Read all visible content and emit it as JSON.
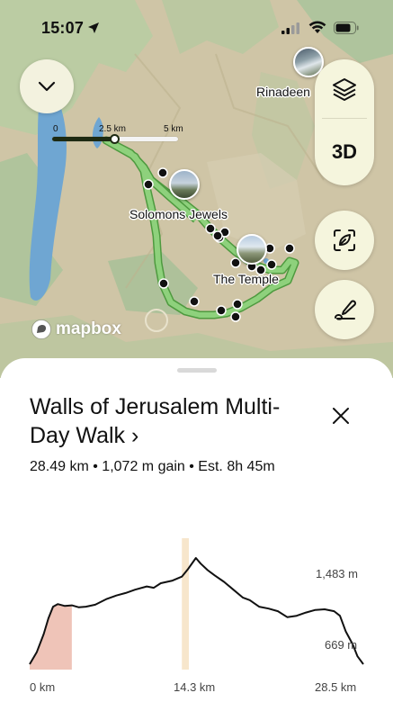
{
  "status_bar": {
    "time": "15:07",
    "icons": [
      "location-arrow-icon",
      "cellular-signal-icon",
      "wifi-icon",
      "battery-icon"
    ]
  },
  "map": {
    "scale": {
      "labels": [
        "0",
        "2.5 km",
        "5 km"
      ]
    },
    "places": [
      {
        "name": "Rinadeena",
        "visible_text": "Rinadeen"
      },
      {
        "name": "Solomons Jewels",
        "visible_text": "Solomons Jewels"
      },
      {
        "name": "The Temple",
        "visible_text": "The Temple"
      }
    ],
    "attribution": "mapbox",
    "buttons": {
      "collapse_icon": "chevron-down-icon",
      "layers_icon": "layers-icon",
      "threed_label": "3D",
      "ar_icon": "leaf-scan-icon",
      "draw_icon": "pen-draw-icon"
    },
    "colors": {
      "route": "#8ed17c",
      "route_outline": "#4e9a3f",
      "track_progress": "#1d2a12",
      "water": "#6fa6d2",
      "terrain": "#cfc5a6",
      "vegetation": "#9fbe94"
    }
  },
  "sheet": {
    "title": "Walls of Jerusalem Multi-Day Walk ›",
    "stats": "28.49 km  •  1,072 m gain  •  Est. 8h 45m",
    "close_icon": "close-icon"
  },
  "elevation_profile": {
    "max_label": "1,483 m",
    "min_label": "669 m",
    "x_labels": [
      "0 km",
      "14.3 km",
      "28.5 km"
    ],
    "total_km": 28.5,
    "y_range": [
      669,
      1483
    ],
    "profile": [
      [
        0,
        669
      ],
      [
        0.6,
        760
      ],
      [
        1.2,
        900
      ],
      [
        1.6,
        1020
      ],
      [
        2.0,
        1110
      ],
      [
        2.4,
        1130
      ],
      [
        3.0,
        1115
      ],
      [
        3.6,
        1120
      ],
      [
        4.2,
        1105
      ],
      [
        4.8,
        1110
      ],
      [
        5.6,
        1125
      ],
      [
        6.6,
        1170
      ],
      [
        7.4,
        1195
      ],
      [
        8.2,
        1215
      ],
      [
        9.0,
        1240
      ],
      [
        10.0,
        1265
      ],
      [
        10.6,
        1255
      ],
      [
        11.2,
        1290
      ],
      [
        12.2,
        1310
      ],
      [
        13.0,
        1340
      ],
      [
        13.5,
        1395
      ],
      [
        13.9,
        1445
      ],
      [
        14.2,
        1483
      ],
      [
        14.6,
        1440
      ],
      [
        15.2,
        1390
      ],
      [
        15.8,
        1350
      ],
      [
        16.6,
        1300
      ],
      [
        17.4,
        1240
      ],
      [
        18.2,
        1180
      ],
      [
        18.8,
        1160
      ],
      [
        19.6,
        1110
      ],
      [
        20.4,
        1095
      ],
      [
        21.2,
        1075
      ],
      [
        22.0,
        1030
      ],
      [
        22.8,
        1040
      ],
      [
        23.6,
        1065
      ],
      [
        24.4,
        1085
      ],
      [
        25.2,
        1090
      ],
      [
        26.0,
        1075
      ],
      [
        26.5,
        1040
      ],
      [
        27.0,
        920
      ],
      [
        27.6,
        820
      ],
      [
        28.0,
        730
      ],
      [
        28.5,
        669
      ]
    ],
    "highlights": [
      {
        "from_km": 0,
        "to_km": 3.6,
        "color": "#efc4b8"
      },
      {
        "from_km": 13.0,
        "to_km": 13.6,
        "color": "#f7e6cc"
      }
    ]
  }
}
